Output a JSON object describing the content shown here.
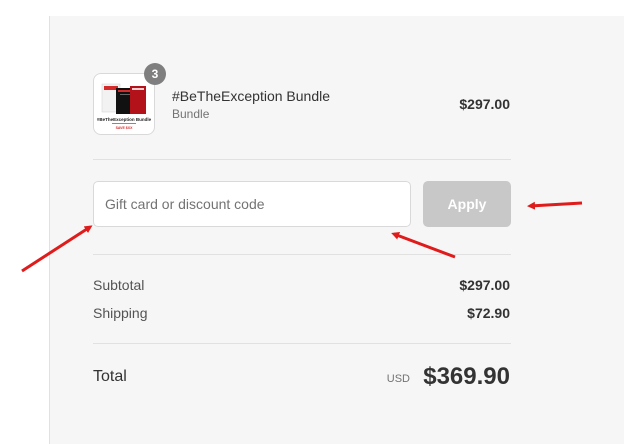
{
  "order": {
    "item": {
      "name": "#BeTheException Bundle",
      "variant": "Bundle",
      "price": "$297.00",
      "quantity": "3",
      "thumbnail_caption": "#BeTheException Bundle",
      "thumbnail_sale_text": "SAVE $XX"
    }
  },
  "discount": {
    "placeholder": "Gift card or discount code",
    "value": "",
    "apply_label": "Apply"
  },
  "summary": {
    "subtotal_label": "Subtotal",
    "subtotal_value": "$297.00",
    "shipping_label": "Shipping",
    "shipping_value": "$72.90",
    "total_label": "Total",
    "currency": "USD",
    "total_value": "$369.90"
  },
  "colors": {
    "panel_bg": "#f6f6f6",
    "apply_disabled": "#c8c8c8",
    "annotation_arrow": "#e01b1b",
    "badge": "#7f7f7f"
  }
}
